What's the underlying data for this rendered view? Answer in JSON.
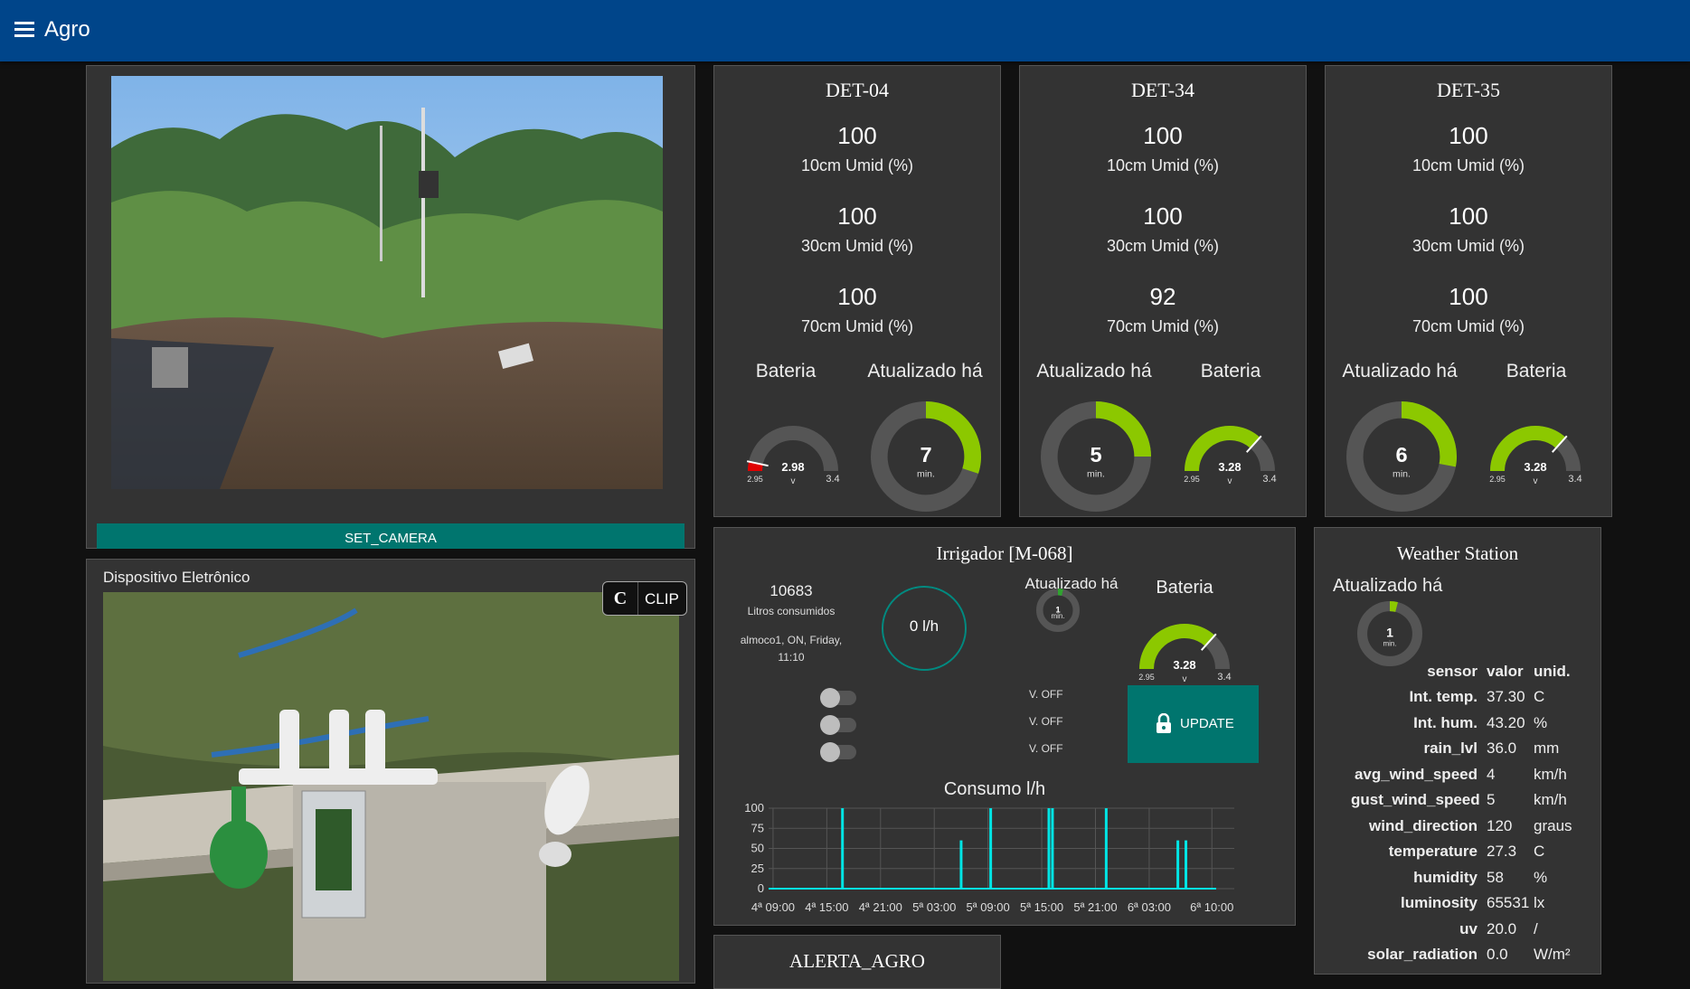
{
  "header": {
    "title": "Agro"
  },
  "camera": {
    "button_label": "SET_CAMERA"
  },
  "device": {
    "title": "Dispositivo Eletrônico",
    "clip_icon_letter": "C",
    "clip_label": "CLIP"
  },
  "dets": [
    {
      "title": "DET-04",
      "v10": "100",
      "l10": "10cm Umid (%)",
      "v30": "100",
      "l30": "30cm Umid (%)",
      "v70": "100",
      "l70": "70cm Umid (%)",
      "left_gauge_title": "Bateria",
      "right_gauge_title": "Atualizado há",
      "battery": {
        "value": "2.98",
        "unit": "v",
        "min": "2.95",
        "max": "3.4",
        "color": "#e00000"
      },
      "updated": {
        "value": "7",
        "unit": "min.",
        "fraction": 0.3
      }
    },
    {
      "title": "DET-34",
      "v10": "100",
      "l10": "10cm Umid (%)",
      "v30": "100",
      "l30": "30cm Umid (%)",
      "v70": "92",
      "l70": "70cm Umid (%)",
      "left_gauge_title": "Atualizado há",
      "right_gauge_title": "Bateria",
      "updated": {
        "value": "5",
        "unit": "min.",
        "fraction": 0.25
      },
      "battery": {
        "value": "3.28",
        "unit": "v",
        "min": "2.95",
        "max": "3.4",
        "color": "#8cc800"
      }
    },
    {
      "title": "DET-35",
      "v10": "100",
      "l10": "10cm Umid (%)",
      "v30": "100",
      "l30": "30cm Umid (%)",
      "v70": "100",
      "l70": "70cm Umid (%)",
      "left_gauge_title": "Atualizado há",
      "right_gauge_title": "Bateria",
      "updated": {
        "value": "6",
        "unit": "min.",
        "fraction": 0.28
      },
      "battery": {
        "value": "3.28",
        "unit": "v",
        "min": "2.95",
        "max": "3.4",
        "color": "#8cc800"
      }
    }
  ],
  "irrigador": {
    "title": "Irrigador [M-068]",
    "liters": "10683",
    "liters_label": "Litros consumidos",
    "schedule_line1": "almoco1, ON, Friday,",
    "schedule_line2": "11:10",
    "flow": "0 l/h",
    "updated_title": "Atualizado há",
    "updated": {
      "value": "1",
      "unit": "min.",
      "fraction": 0.04
    },
    "battery_title": "Bateria",
    "battery": {
      "value": "3.28",
      "unit": "v",
      "min": "2.95",
      "max": "3.4",
      "color": "#8cc800"
    },
    "valves": [
      "V. OFF",
      "V. OFF",
      "V. OFF"
    ],
    "update_label": "UPDATE"
  },
  "chart_data": {
    "type": "bar",
    "title": "Consumo l/h",
    "ylim": [
      0,
      100
    ],
    "yticks": [
      "100",
      "75",
      "50",
      "25",
      "0"
    ],
    "xticks": [
      "4ª 09:00",
      "4ª 15:00",
      "4ª 21:00",
      "5ª 03:00",
      "5ª 09:00",
      "5ª 15:00",
      "5ª 21:00",
      "6ª 03:00",
      "6ª 10:00"
    ],
    "x_hours": [
      0,
      6,
      12,
      18,
      24,
      30,
      36,
      42,
      49
    ],
    "x_range": [
      -0.5,
      51.5
    ],
    "spikes": [
      {
        "hour": 7.75,
        "value": 100
      },
      {
        "hour": 21.0,
        "value": 60
      },
      {
        "hour": 24.3,
        "value": 100
      },
      {
        "hour": 30.8,
        "value": 100
      },
      {
        "hour": 31.2,
        "value": 100
      },
      {
        "hour": 37.2,
        "value": 100
      },
      {
        "hour": 45.2,
        "value": 60
      },
      {
        "hour": 46.1,
        "value": 60
      }
    ],
    "color": "#00e5e5",
    "grid": true
  },
  "weather": {
    "title": "Weather Station",
    "updated_title": "Atualizado há",
    "updated": {
      "value": "1",
      "unit": "min.",
      "fraction": 0.04
    },
    "headers": {
      "sensor": "sensor",
      "value": "valor",
      "unit": "unid."
    },
    "rows": [
      {
        "sensor": "Int. temp.",
        "value": "37.30",
        "unit": "C"
      },
      {
        "sensor": "Int. hum.",
        "value": "43.20",
        "unit": "%"
      },
      {
        "sensor": "rain_lvl",
        "value": "36.0",
        "unit": "mm"
      },
      {
        "sensor": "avg_wind_speed",
        "value": "4",
        "unit": "km/h"
      },
      {
        "sensor": "gust_wind_speed",
        "value": "5",
        "unit": "km/h"
      },
      {
        "sensor": "wind_direction",
        "value": "120",
        "unit": "graus"
      },
      {
        "sensor": "temperature",
        "value": "27.3",
        "unit": "C"
      },
      {
        "sensor": "humidity",
        "value": "58",
        "unit": "%"
      },
      {
        "sensor": "luminosity",
        "value": "65531",
        "unit": "lx"
      },
      {
        "sensor": "uv",
        "value": "20.0",
        "unit": "/"
      },
      {
        "sensor": "solar_radiation",
        "value": "0.0",
        "unit": "W/m²"
      }
    ]
  },
  "alert": {
    "title": "ALERTA_AGRO"
  }
}
